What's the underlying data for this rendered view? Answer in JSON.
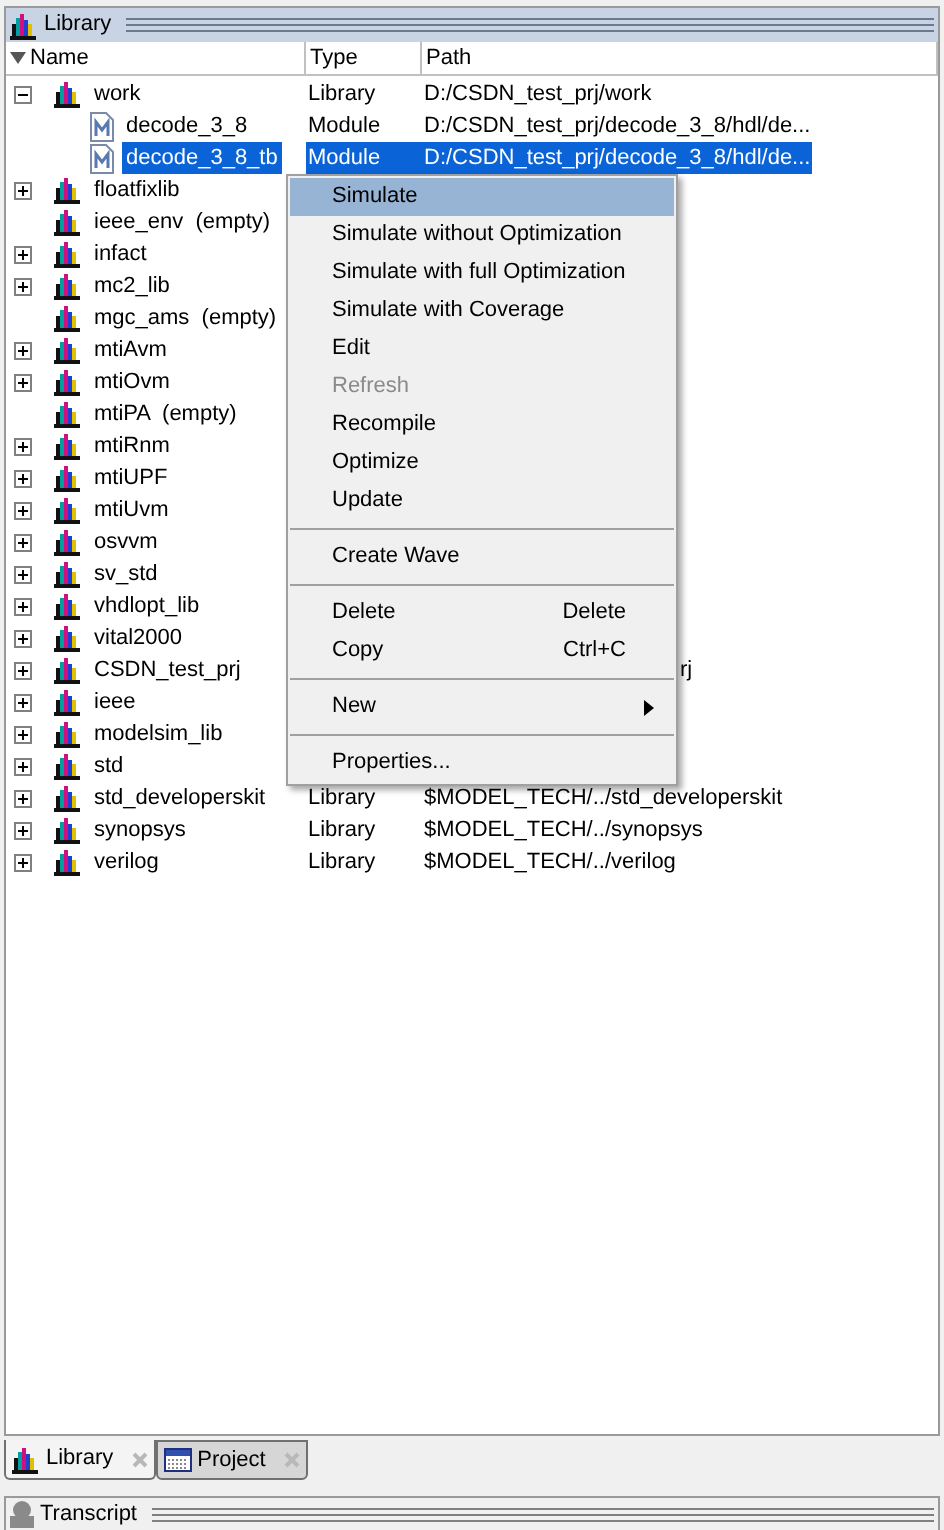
{
  "panel": {
    "title": "Library"
  },
  "columns": [
    "Name",
    "Type",
    "Path"
  ],
  "rows": [
    {
      "name": "work",
      "kind": "library",
      "expanded": true,
      "selected": false,
      "type": "Library",
      "path": "D:/CSDN_test_prj/work",
      "children": [
        {
          "name": "decode_3_8",
          "kind": "module",
          "selected": false,
          "type": "Module",
          "path": "D:/CSDN_test_prj/decode_3_8/hdl/de..."
        },
        {
          "name": "decode_3_8_tb",
          "kind": "module",
          "selected": true,
          "type": "Module",
          "path": "D:/CSDN_test_prj/decode_3_8/hdl/de..."
        }
      ]
    },
    {
      "name": "floatfixlib",
      "kind": "library",
      "expanded": false,
      "selected": false
    },
    {
      "name": "ieee_env  (empty)",
      "kind": "empty_library",
      "selected": false
    },
    {
      "name": "infact",
      "kind": "library",
      "expanded": false,
      "selected": false
    },
    {
      "name": "mc2_lib",
      "kind": "library",
      "expanded": false,
      "selected": false
    },
    {
      "name": "mgc_ams  (empty)",
      "kind": "empty_library",
      "selected": false
    },
    {
      "name": "mtiAvm",
      "kind": "library",
      "expanded": false,
      "selected": false
    },
    {
      "name": "mtiOvm",
      "kind": "library",
      "expanded": false,
      "selected": false
    },
    {
      "name": "mtiPA  (empty)",
      "kind": "empty_library",
      "selected": false
    },
    {
      "name": "mtiRnm",
      "kind": "library",
      "expanded": false,
      "selected": false
    },
    {
      "name": "mtiUPF",
      "kind": "library",
      "expanded": false,
      "selected": false
    },
    {
      "name": "mtiUvm",
      "kind": "library",
      "expanded": false,
      "selected": false
    },
    {
      "name": "osvvm",
      "kind": "library",
      "expanded": false,
      "selected": false
    },
    {
      "name": "sv_std",
      "kind": "library",
      "expanded": false,
      "selected": false
    },
    {
      "name": "vhdlopt_lib",
      "kind": "library",
      "expanded": false,
      "selected": false
    },
    {
      "name": "vital2000",
      "kind": "library",
      "expanded": false,
      "selected": false
    },
    {
      "name": "CSDN_test_prj",
      "kind": "library",
      "expanded": false,
      "selected": false,
      "path_tail": "rj"
    },
    {
      "name": "ieee",
      "kind": "library",
      "expanded": false,
      "selected": false
    },
    {
      "name": "modelsim_lib",
      "kind": "library",
      "expanded": false,
      "selected": false
    },
    {
      "name": "std",
      "kind": "library",
      "expanded": false,
      "selected": false
    },
    {
      "name": "std_developerskit",
      "kind": "library",
      "expanded": false,
      "selected": false,
      "type": "Library",
      "path": "$MODEL_TECH/../std_developerskit"
    },
    {
      "name": "synopsys",
      "kind": "library",
      "expanded": false,
      "selected": false,
      "type": "Library",
      "path": "$MODEL_TECH/../synopsys"
    },
    {
      "name": "verilog",
      "kind": "library",
      "expanded": false,
      "selected": false,
      "type": "Library",
      "path": "$MODEL_TECH/../verilog"
    }
  ],
  "context_menu": [
    {
      "kind": "item",
      "label": "Simulate",
      "selected": true,
      "disabled": false
    },
    {
      "kind": "item",
      "label": "Simulate without Optimization",
      "selected": false,
      "disabled": false
    },
    {
      "kind": "item",
      "label": "Simulate with full Optimization",
      "selected": false,
      "disabled": false
    },
    {
      "kind": "item",
      "label": "Simulate with Coverage",
      "selected": false,
      "disabled": false
    },
    {
      "kind": "item",
      "label": "Edit",
      "selected": false,
      "disabled": false
    },
    {
      "kind": "item",
      "label": "Refresh",
      "selected": false,
      "disabled": true
    },
    {
      "kind": "item",
      "label": "Recompile",
      "selected": false,
      "disabled": false
    },
    {
      "kind": "item",
      "label": "Optimize",
      "selected": false,
      "disabled": false
    },
    {
      "kind": "item",
      "label": "Update",
      "selected": false,
      "disabled": false
    },
    {
      "kind": "separator"
    },
    {
      "kind": "item",
      "label": "Create Wave",
      "selected": false,
      "disabled": false
    },
    {
      "kind": "separator"
    },
    {
      "kind": "item",
      "label": "Delete",
      "shortcut": "Delete",
      "selected": false,
      "disabled": false
    },
    {
      "kind": "item",
      "label": "Copy",
      "shortcut": "Ctrl+C",
      "selected": false,
      "disabled": false
    },
    {
      "kind": "separator"
    },
    {
      "kind": "submenu",
      "label": "New",
      "selected": false,
      "disabled": false
    },
    {
      "kind": "separator"
    },
    {
      "kind": "item",
      "label": "Properties...",
      "selected": false,
      "disabled": false
    }
  ],
  "bottom_tabs": [
    {
      "label": "Library",
      "kind": "library",
      "selected": true
    },
    {
      "label": "Project",
      "kind": "project",
      "selected": false
    }
  ],
  "next_panel": {
    "title": "Transcript"
  }
}
